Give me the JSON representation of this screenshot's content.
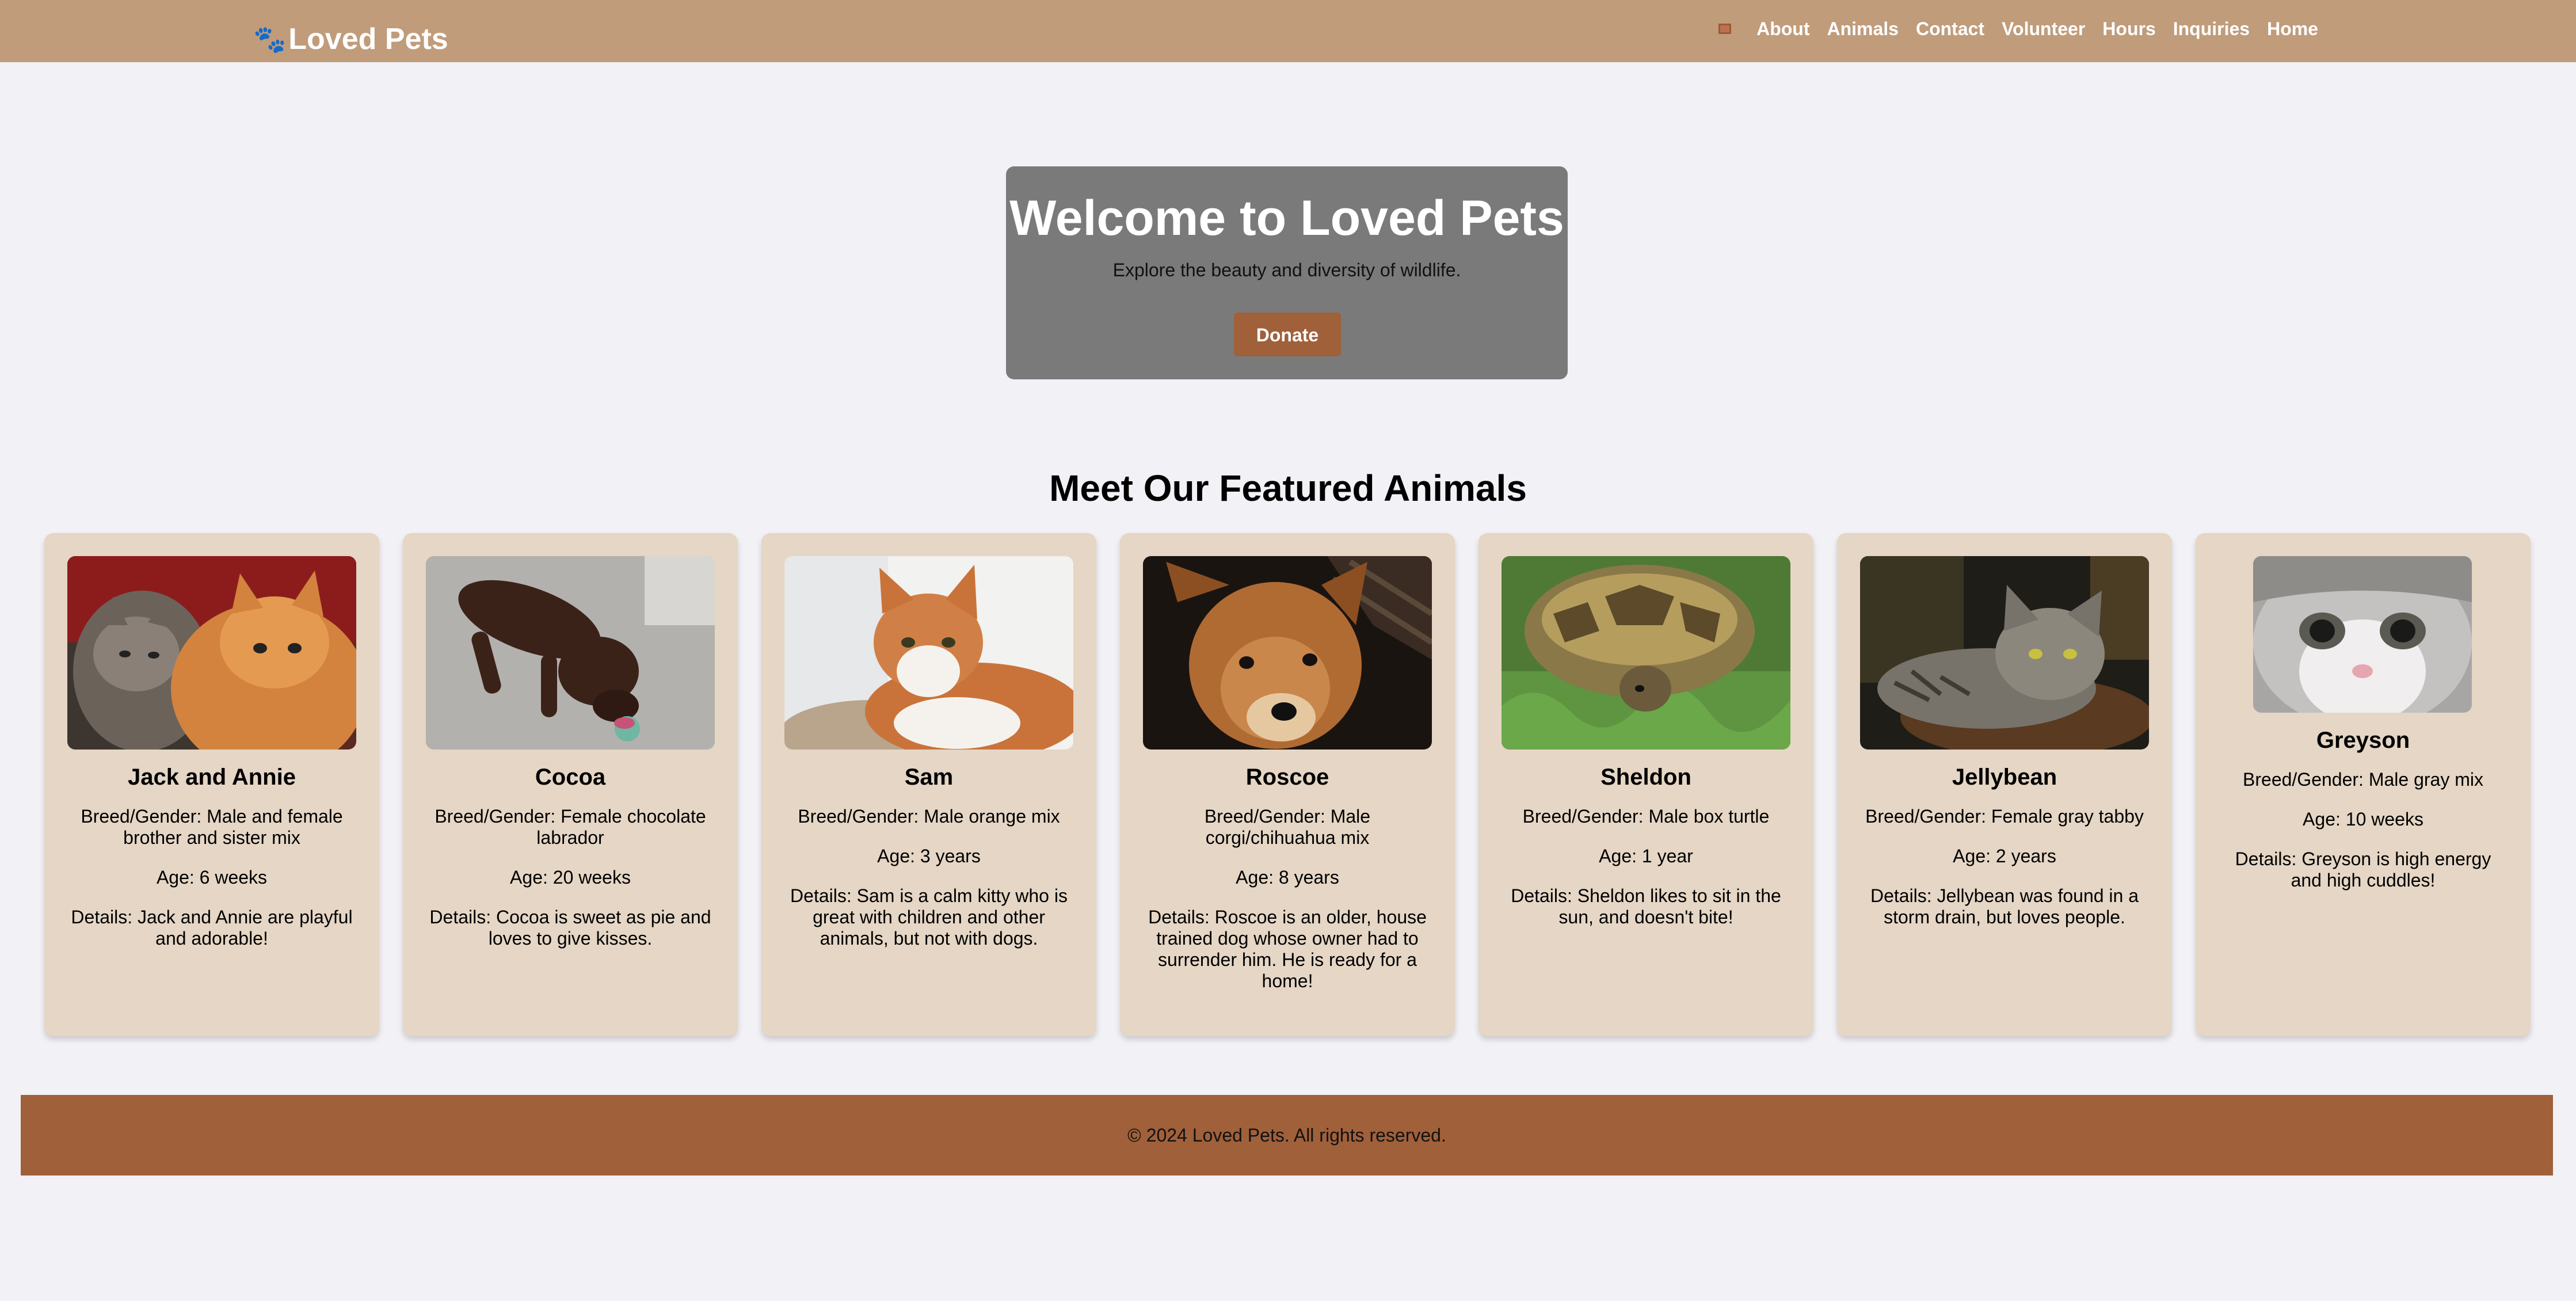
{
  "header": {
    "brand_icon": "paw-icon",
    "brand": "Loved Pets",
    "flag_icon": "flag-icon",
    "nav": [
      "About",
      "Animals",
      "Contact",
      "Volunteer",
      "Hours",
      "Inquiries",
      "Home"
    ]
  },
  "hero": {
    "title": "Welcome to Loved Pets",
    "subtitle": "Explore the beauty and diversity of wildlife.",
    "button": "Donate"
  },
  "featured": {
    "title": "Meet Our Featured Animals",
    "animals": [
      {
        "name": "Jack and Annie",
        "breed": "Breed/Gender: Male and female brother and sister mix",
        "age": "Age: 6 weeks",
        "details": "Details: Jack and Annie are playful and adorable!"
      },
      {
        "name": "Cocoa",
        "breed": "Breed/Gender: Female chocolate labrador",
        "age": "Age: 20 weeks",
        "details": "Details: Cocoa is sweet as pie and loves to give kisses."
      },
      {
        "name": "Sam",
        "breed": "Breed/Gender: Male orange mix",
        "age": "Age: 3 years",
        "details": "Details: Sam is a calm kitty who is great with children and other animals, but not with dogs."
      },
      {
        "name": "Roscoe",
        "breed": "Breed/Gender: Male corgi/chihuahua mix",
        "age": "Age: 8 years",
        "details": "Details: Roscoe is an older, house trained dog whose owner had to surrender him. He is ready for a home!"
      },
      {
        "name": "Sheldon",
        "breed": "Breed/Gender: Male box turtle",
        "age": "Age: 1 year",
        "details": "Details: Sheldon likes to sit in the sun, and doesn't bite!"
      },
      {
        "name": "Jellybean",
        "breed": "Breed/Gender: Female gray tabby",
        "age": "Age: 2 years",
        "details": "Details: Jellybean was found in a storm drain, but loves people."
      },
      {
        "name": "Greyson",
        "breed": "Breed/Gender: Male gray mix",
        "age": "Age: 10 weeks",
        "details": "Details: Greyson is high energy and high cuddles!"
      }
    ]
  },
  "footer": {
    "text": "© 2024 Loved Pets. All rights reserved."
  },
  "colors": {
    "header_bg": "#c09c7b",
    "page_bg": "#f2f1f6",
    "hero_bg": "#7a7a7a",
    "accent": "#a0603a",
    "card_bg": "#e5d6c5"
  }
}
